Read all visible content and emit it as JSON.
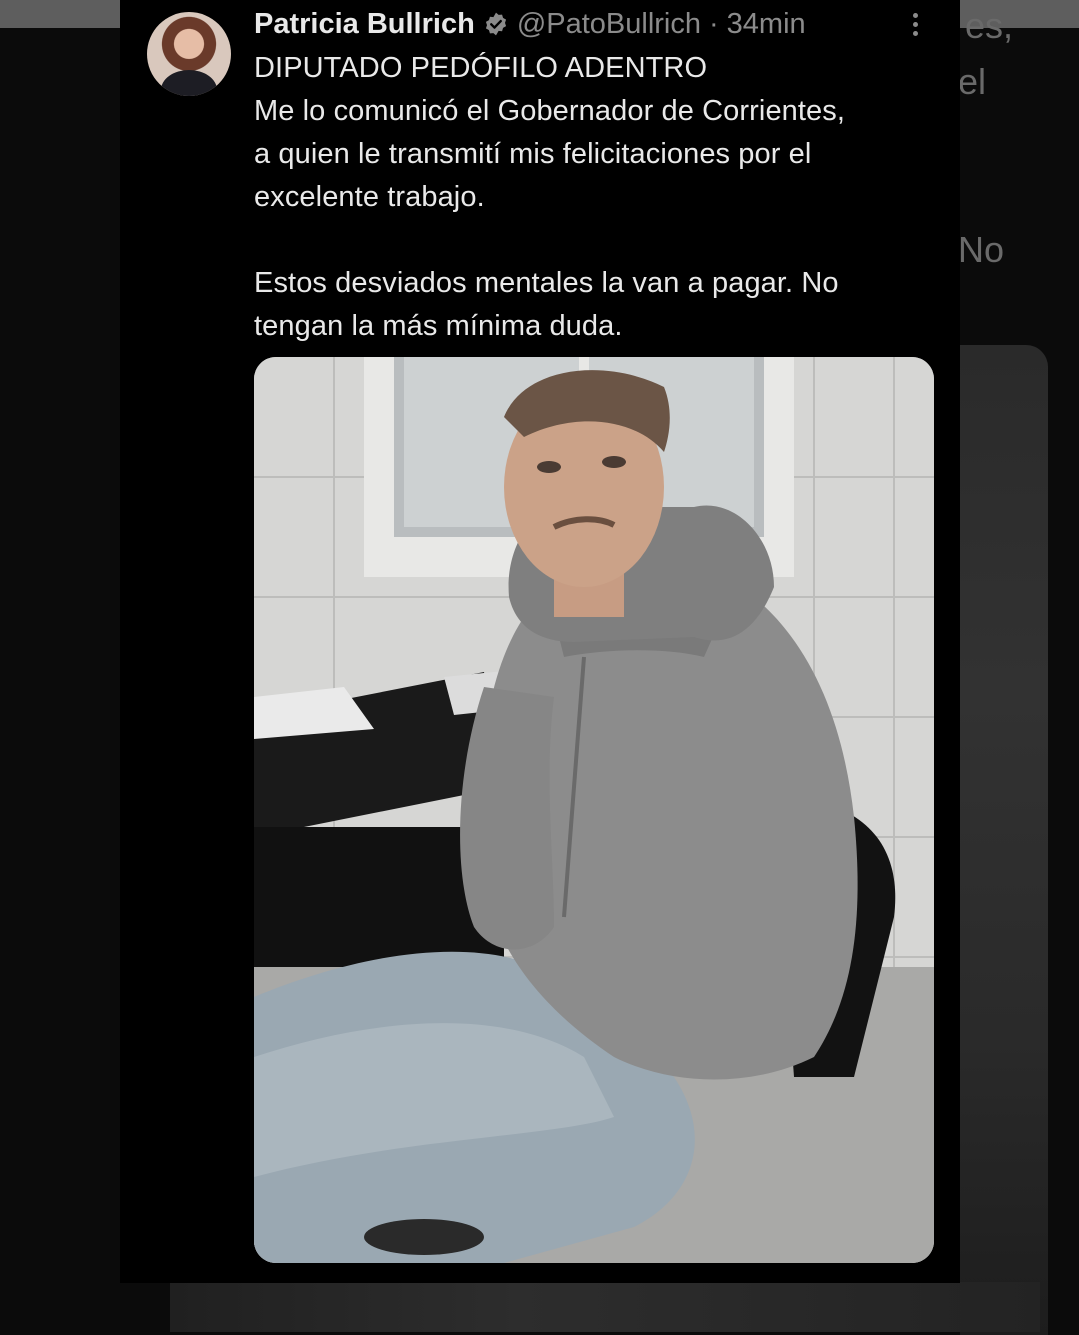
{
  "tweet": {
    "author_name": "Patricia Bullrich",
    "handle": "@PatoBullrich",
    "separator": "·",
    "timestamp": "34min",
    "lines": [
      "DIPUTADO PEDÓFILO ADENTRO",
      "Me lo comunicó el Gobernador de Corrientes,",
      "a quien le transmití mis felicitaciones por el",
      "excelente trabajo.",
      "Estos desviados mentales la van a pagar. No",
      "tengan la más mínima duda."
    ]
  },
  "background": {
    "fragment_1": "es,",
    "fragment_2": "el",
    "fragment_3": "No"
  },
  "colors": {
    "background": "#000000",
    "text_primary": "#e9e9e9",
    "text_secondary": "#8b8b8b",
    "verified_badge": "#8b8b8b"
  },
  "icons": {
    "verified": "verified-badge-icon",
    "more": "more-options-icon"
  }
}
